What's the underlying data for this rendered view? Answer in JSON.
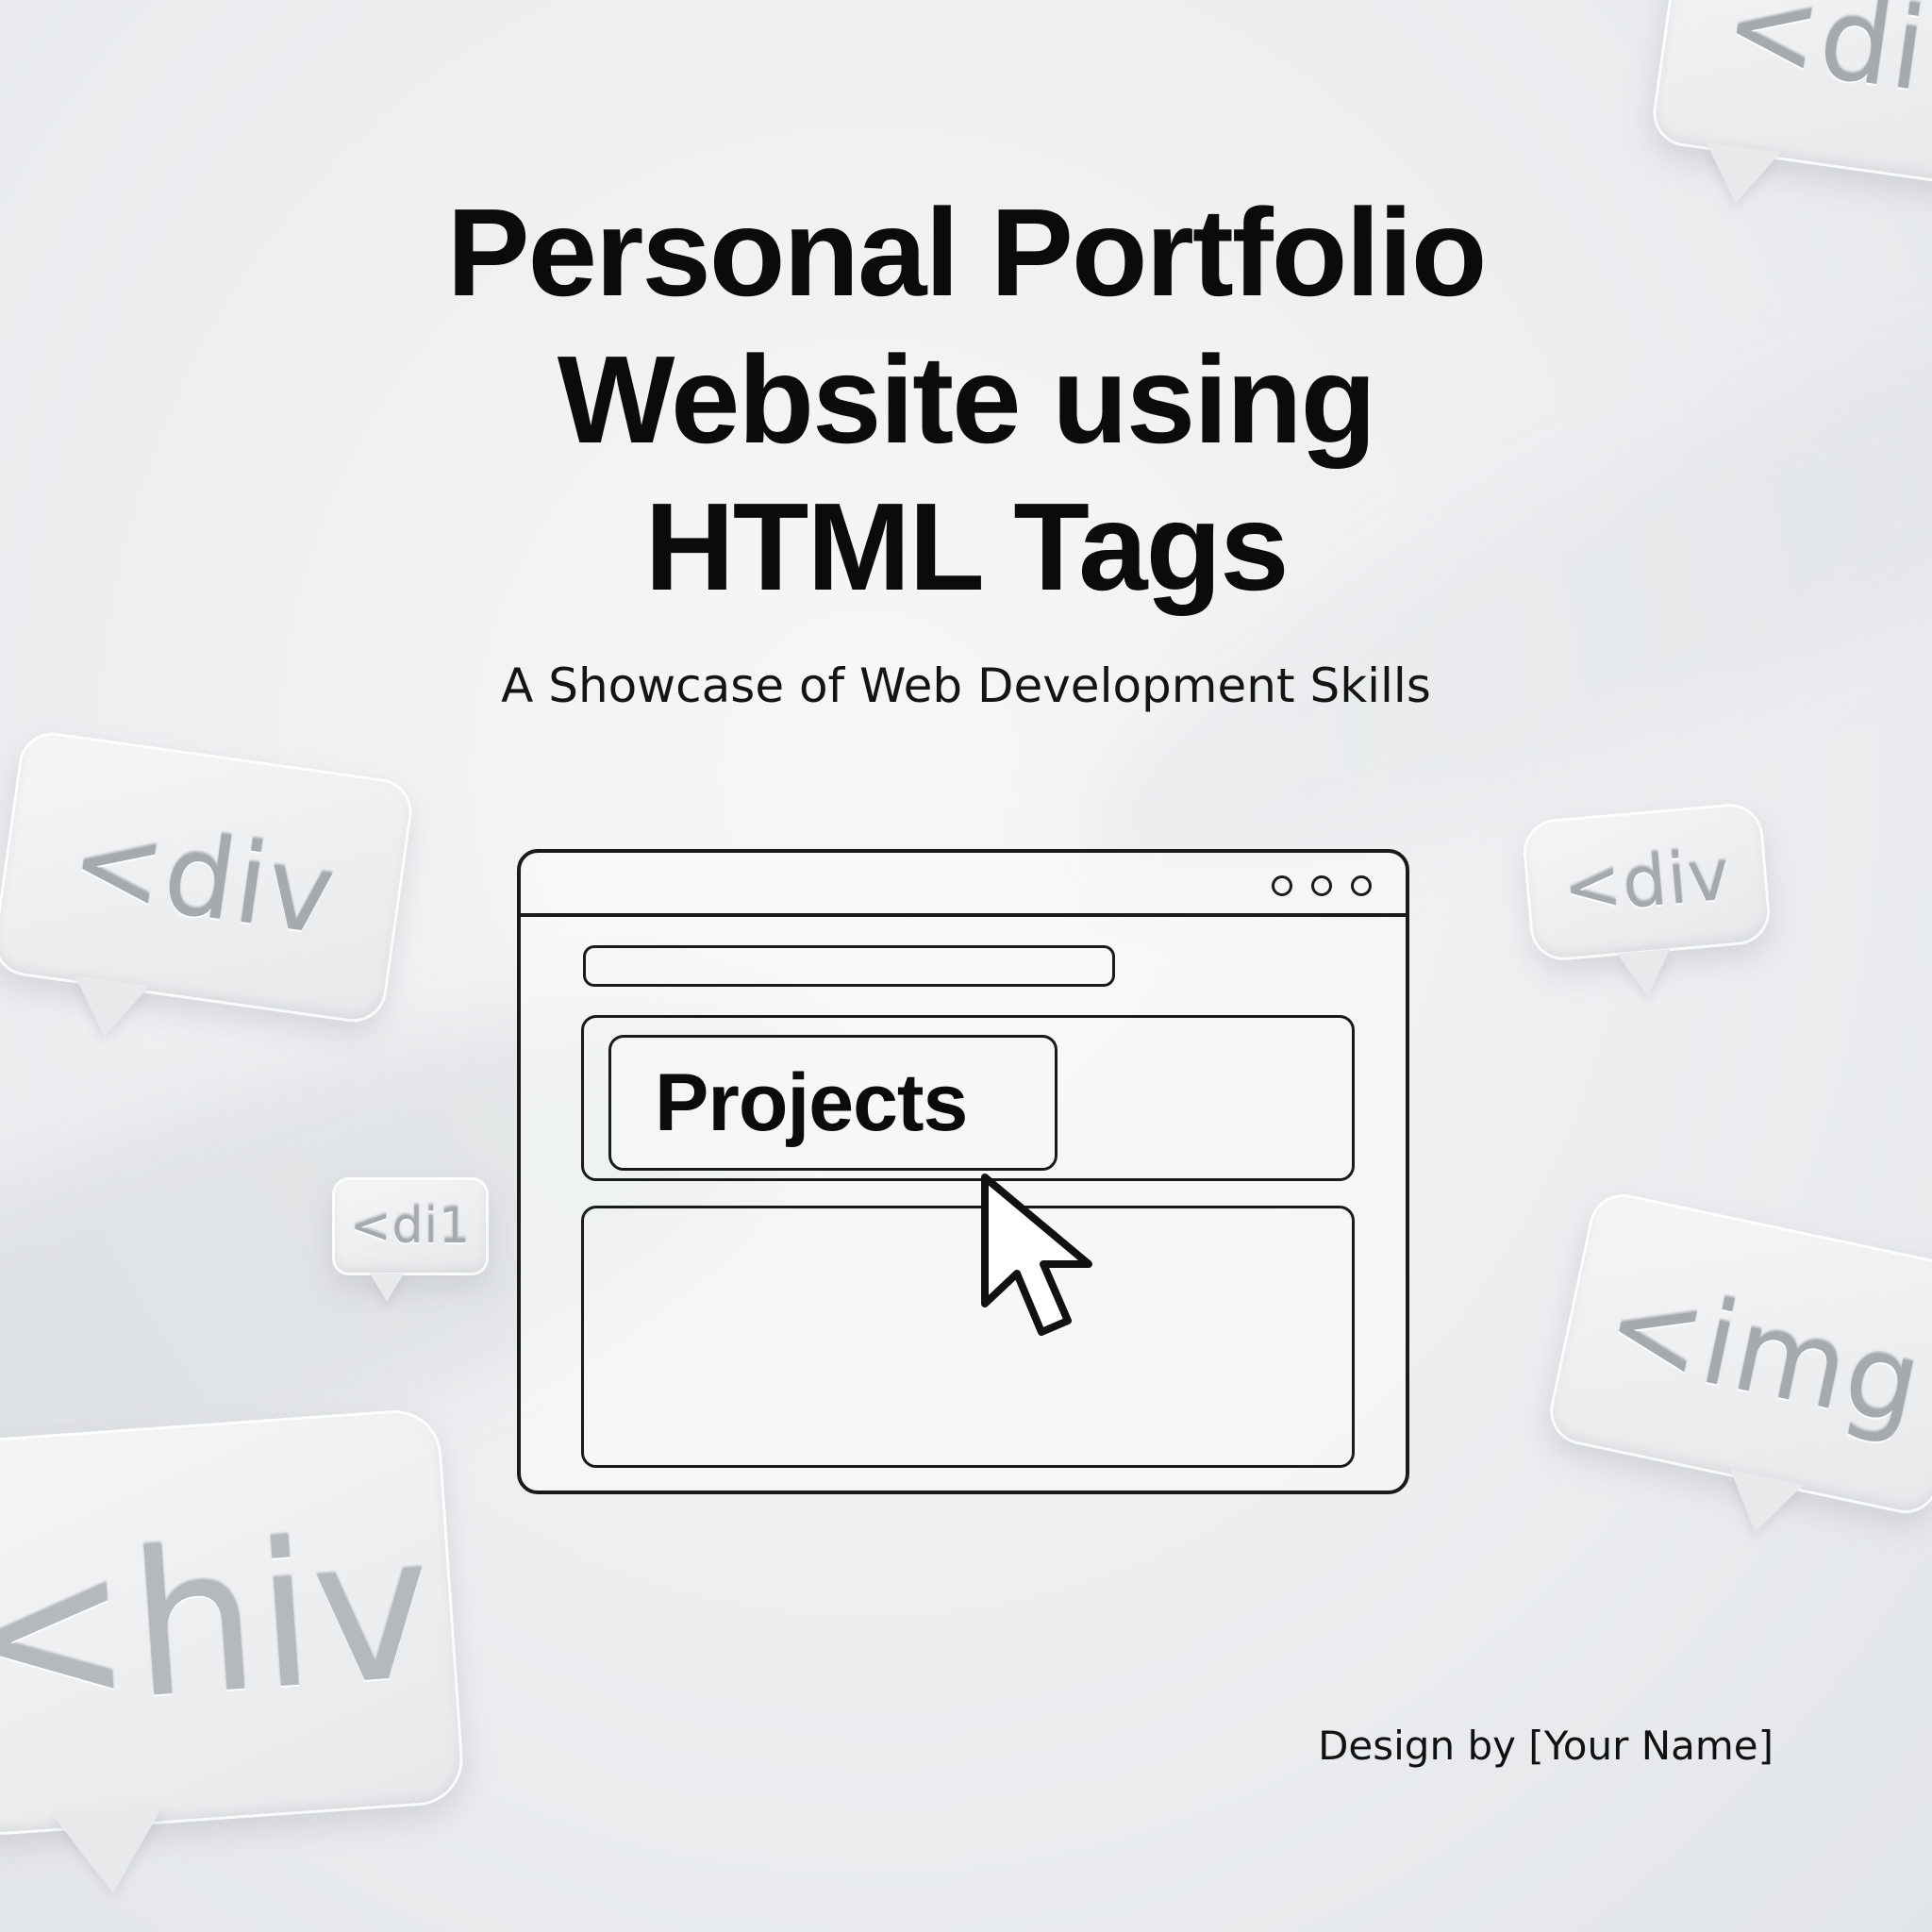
{
  "title": {
    "line1": "Personal Portfolio",
    "line2": "Website using",
    "line3": "HTML Tags"
  },
  "subtitle": "A Showcase of Web Development Skills",
  "browser_mockup": {
    "button_label": "Projects"
  },
  "floating_tags": {
    "left": "<div",
    "top_right": "<di",
    "right_mid": "<div",
    "small": "<di1",
    "right_low": "<img",
    "bottom_left": "<hiv"
  },
  "credit": "Design by [Your Name]",
  "colors": {
    "background": "#eceef0",
    "text": "#0b0b0b",
    "outline": "#1a1a1a",
    "tag_text": "#a5aaaf"
  },
  "icons": {
    "cursor": "mouse-pointer-icon",
    "window_controls": "window-dots-icon"
  }
}
